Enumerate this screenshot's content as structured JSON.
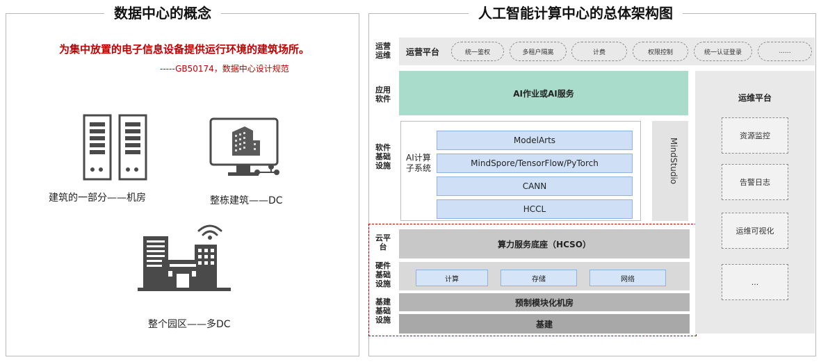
{
  "left": {
    "title": "数据中心的概念",
    "definition": "为集中放置的电子信息设备提供运行环境的建筑场所。",
    "source": "-----GB50174，数据中心设计规范",
    "items": [
      {
        "caption": "建筑的一部分——机房"
      },
      {
        "caption": "整栋建筑——DC"
      },
      {
        "caption": "整个园区——多DC"
      }
    ]
  },
  "right": {
    "title": "人工智能计算中心的总体架构图",
    "row_labels": {
      "ops": "运营\n运维",
      "app": "应用\n软件",
      "soft": "软件\n基础\n设施",
      "cloud": "云平\n台",
      "hw": "硬件\n基础\n设施",
      "infra": "基建\n基础\n设施"
    },
    "ops_platform": {
      "label": "运营平台",
      "items": [
        "统一鉴权",
        "多租户隔离",
        "计费",
        "权限控制",
        "统一认证登录",
        "......"
      ]
    },
    "app_service": "AI作业或AI服务",
    "ai_subsystem": {
      "label": "AI计算\n子系统",
      "layers": [
        "ModelArts",
        "MindSpore/TensorFlow/PyTorch",
        "CANN",
        "HCCL"
      ]
    },
    "mindstudio": "MindStudio",
    "hcso": "算力服务底座（HCSO）",
    "hardware": [
      "计算",
      "存储",
      "网络"
    ],
    "prefab": "预制模块化机房",
    "infra": "基建",
    "maintenance": {
      "title": "运维平台",
      "items": [
        "资源监控",
        "告警日志",
        "运维可视化",
        "..."
      ]
    }
  }
}
